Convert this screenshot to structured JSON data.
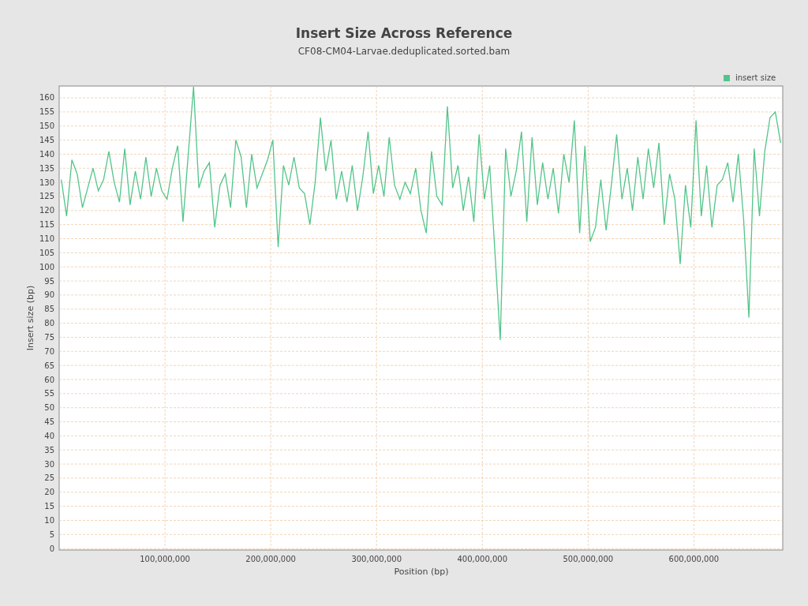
{
  "chart_data": {
    "type": "line",
    "title": "Insert Size Across Reference",
    "subtitle": "CF08-CM04-Larvae.deduplicated.sorted.bam",
    "xlabel": "Position (bp)",
    "ylabel": "Insert size (bp)",
    "grid": true,
    "xlim": [
      0,
      684000000
    ],
    "ylim": [
      -0.5,
      164.2
    ],
    "x": [
      2000000,
      7000000,
      12000000,
      17000000,
      22000000,
      27000000,
      32000000,
      37000000,
      42000000,
      47000000,
      52000000,
      57000000,
      62000000,
      67000000,
      72000000,
      77000000,
      82000000,
      87000000,
      92000000,
      97000000,
      102000000,
      107000000,
      112000000,
      117000000,
      122000000,
      127000000,
      132000000,
      137000000,
      142000000,
      147000000,
      152000000,
      157000000,
      162000000,
      167000000,
      172000000,
      177000000,
      182000000,
      187000000,
      192000000,
      197000000,
      202000000,
      207000000,
      212000000,
      217000000,
      222000000,
      227000000,
      232000000,
      237000000,
      242000000,
      247000000,
      252000000,
      257000000,
      262000000,
      267000000,
      272000000,
      277000000,
      282000000,
      287000000,
      292000000,
      297000000,
      302000000,
      307000000,
      312000000,
      317000000,
      322000000,
      327000000,
      332000000,
      337000000,
      342000000,
      347000000,
      352000000,
      357000000,
      362000000,
      367000000,
      372000000,
      377000000,
      382000000,
      387000000,
      392000000,
      397000000,
      402000000,
      407000000,
      412000000,
      417000000,
      422000000,
      427000000,
      432000000,
      437000000,
      442000000,
      447000000,
      452000000,
      457000000,
      462000000,
      467000000,
      472000000,
      477000000,
      482000000,
      487000000,
      492000000,
      497000000,
      502000000,
      507000000,
      512000000,
      517000000,
      522000000,
      527000000,
      532000000,
      537000000,
      542000000,
      547000000,
      552000000,
      557000000,
      562000000,
      567000000,
      572000000,
      577000000,
      582000000,
      587000000,
      592000000,
      597000000,
      602000000,
      607000000,
      612000000,
      617000000,
      622000000,
      627000000,
      632000000,
      637000000,
      642000000,
      647000000,
      652000000,
      657000000,
      662000000,
      667000000,
      672000000,
      677000000,
      682000000
    ],
    "xticks": [
      {
        "value": 100000000,
        "label": "100,000,000"
      },
      {
        "value": 200000000,
        "label": "200,000,000"
      },
      {
        "value": 300000000,
        "label": "300,000,000"
      },
      {
        "value": 400000000,
        "label": "400,000,000"
      },
      {
        "value": 500000000,
        "label": "500,000,000"
      },
      {
        "value": 600000000,
        "label": "600,000,000"
      }
    ],
    "yticks": [
      0,
      5,
      10,
      15,
      20,
      25,
      30,
      35,
      40,
      45,
      50,
      55,
      60,
      65,
      70,
      75,
      80,
      85,
      90,
      95,
      100,
      105,
      110,
      115,
      120,
      125,
      130,
      135,
      140,
      145,
      150,
      155,
      160
    ],
    "series": [
      {
        "name": "insert size",
        "color": "#52c58a",
        "values": [
          131,
          118,
          138,
          133,
          121,
          128,
          135,
          127,
          131,
          141,
          130,
          123,
          142,
          122,
          134,
          124,
          139,
          125,
          135,
          127,
          124,
          135,
          143,
          116,
          140,
          164,
          128,
          134,
          137,
          114,
          129,
          133,
          121,
          145,
          139,
          121,
          140,
          128,
          133,
          138,
          145,
          107,
          136,
          129,
          139,
          128,
          126,
          115,
          130,
          153,
          134,
          145,
          124,
          134,
          123,
          136,
          120,
          132,
          148,
          126,
          136,
          125,
          146,
          129,
          124,
          130,
          126,
          135,
          120,
          112,
          141,
          125,
          122,
          157,
          128,
          136,
          120,
          132,
          116,
          147,
          124,
          136,
          105,
          74,
          142,
          125,
          134,
          148,
          116,
          146,
          122,
          137,
          124,
          135,
          119,
          140,
          130,
          152,
          112,
          143,
          109,
          114,
          131,
          113,
          129,
          147,
          124,
          135,
          120,
          139,
          124,
          142,
          128,
          144,
          115,
          133,
          124,
          101,
          129,
          114,
          152,
          118,
          136,
          114,
          129,
          131,
          137,
          123,
          140,
          117,
          82,
          142,
          118,
          141,
          153,
          155,
          144
        ]
      }
    ]
  }
}
